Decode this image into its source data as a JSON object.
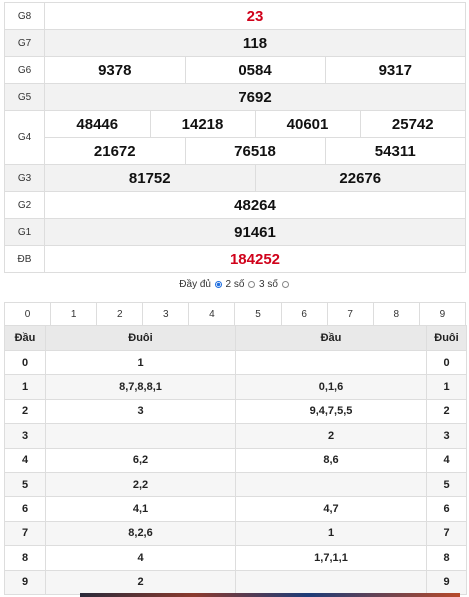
{
  "prizes": {
    "g8": {
      "label": "G8",
      "numbers": [
        "23"
      ]
    },
    "g7": {
      "label": "G7",
      "numbers": [
        "118"
      ]
    },
    "g6": {
      "label": "G6",
      "numbers": [
        "9378",
        "0584",
        "9317"
      ]
    },
    "g5": {
      "label": "G5",
      "numbers": [
        "7692"
      ]
    },
    "g4": {
      "label": "G4",
      "row1": [
        "48446",
        "14218",
        "40601",
        "25742"
      ],
      "row2": [
        "21672",
        "76518",
        "54311"
      ]
    },
    "g3": {
      "label": "G3",
      "numbers": [
        "81752",
        "22676"
      ]
    },
    "g2": {
      "label": "G2",
      "numbers": [
        "48264"
      ]
    },
    "g1": {
      "label": "G1",
      "numbers": [
        "91461"
      ]
    },
    "db": {
      "label": "ĐB",
      "numbers": [
        "184252"
      ]
    }
  },
  "display_options": {
    "full": "Đầy đủ",
    "two_digits": "2 số",
    "three_digits": "3 số",
    "selected": "two_digits"
  },
  "digit_filter": [
    "0",
    "1",
    "2",
    "3",
    "4",
    "5",
    "6",
    "7",
    "8",
    "9"
  ],
  "loto_table": {
    "headers": [
      "Đầu",
      "Đuôi",
      "Đầu",
      "Đuôi"
    ],
    "rows": [
      {
        "head": "0",
        "tail": "1",
        "head2": "",
        "tail2": "0"
      },
      {
        "head": "1",
        "tail": "8,7,8,8,1",
        "head2": "0,1,6",
        "tail2": "1"
      },
      {
        "head": "2",
        "tail": "3",
        "head2": "9,4,7,5,5",
        "tail2": "2"
      },
      {
        "head": "3",
        "tail": "",
        "head2": "2",
        "tail2": "3"
      },
      {
        "head": "4",
        "tail": "6,2",
        "head2": "8,6",
        "tail2": "4"
      },
      {
        "head": "5",
        "tail": "2,2",
        "head2": "",
        "tail2": "5"
      },
      {
        "head": "6",
        "tail": "4,1",
        "head2": "4,7",
        "tail2": "6"
      },
      {
        "head": "7",
        "tail": "8,2,6",
        "head2": "1",
        "tail2": "7"
      },
      {
        "head": "8",
        "tail": "4",
        "head2": "1,7,1,1",
        "tail2": "8"
      },
      {
        "head": "9",
        "tail": "2",
        "head2": "",
        "tail2": "9"
      }
    ]
  },
  "colors": {
    "special_prize": "#d0021b",
    "g8": "#d0021b",
    "radio_selected": "#1e6ee0"
  }
}
